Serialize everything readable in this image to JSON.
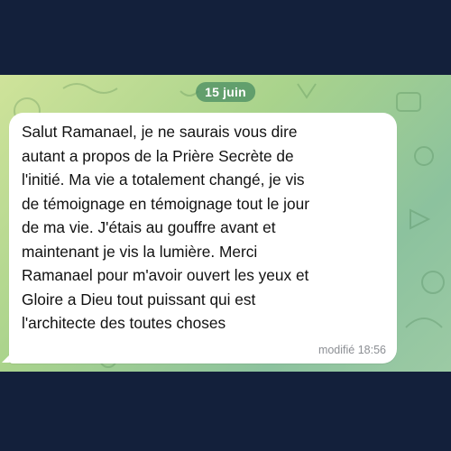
{
  "chat": {
    "date_label": "15 juin",
    "message": {
      "text": "Salut Ramanael, je ne saurais vous dire\nautant a propos de la Prière Secrète de\nl'initié. Ma vie a totalement changé, je vis\nde témoignage en témoignage tout le jour\nde ma vie. J'étais au gouffre avant et\nmaintenant je vis la lumière. Merci\nRamanael pour m'avoir ouvert les yeux et\nGloire a Dieu tout puissant qui est\nl'architecte des toutes choses",
      "edited_label": "modifié",
      "time": "18:56"
    }
  },
  "colors": {
    "frame": "#13203b",
    "bubble": "#ffffff",
    "date_pill": "#488c62"
  }
}
